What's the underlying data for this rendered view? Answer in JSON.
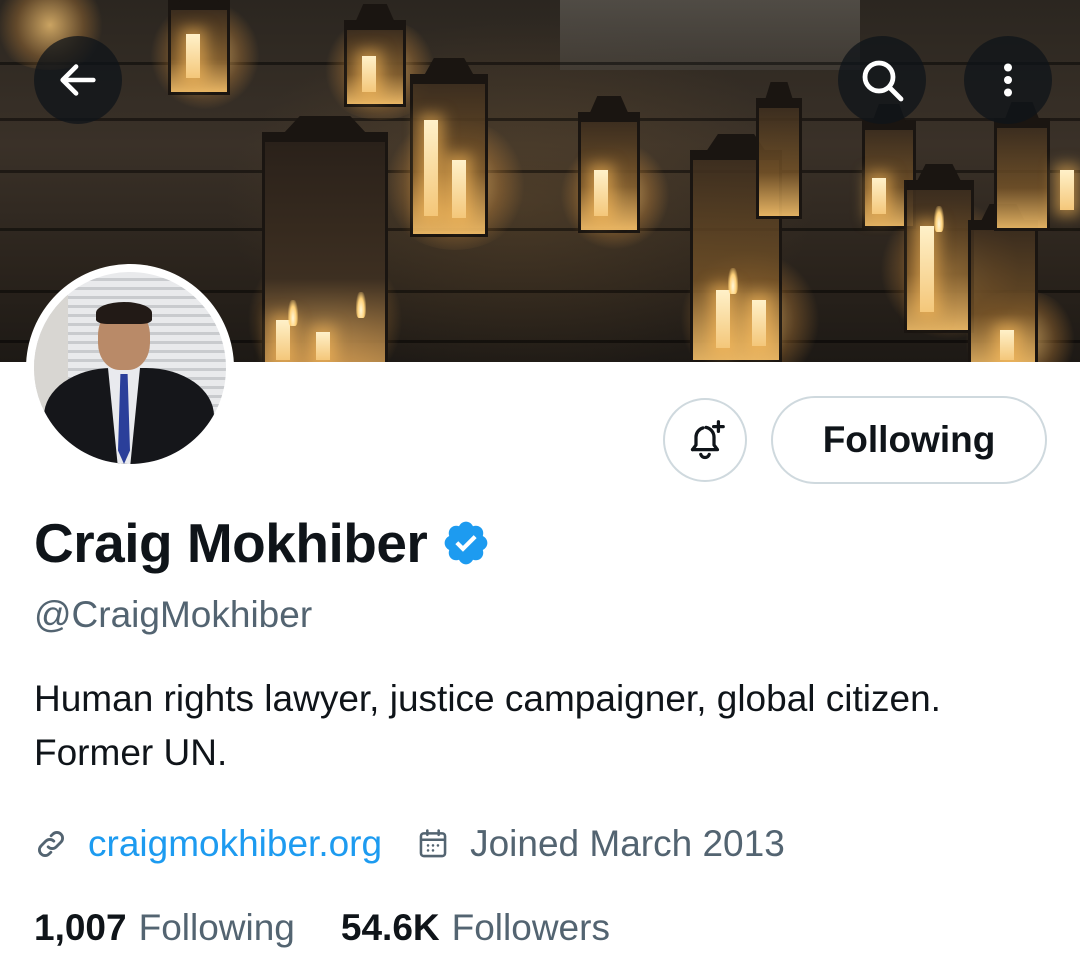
{
  "profile": {
    "display_name": "Craig Mokhiber",
    "handle": "@CraigMokhiber",
    "bio": "Human rights lawyer, justice campaigner, global citizen. Former UN.",
    "website": "craigmokhiber.org",
    "joined": "Joined March 2013",
    "verified": true
  },
  "actions": {
    "following_label": "Following"
  },
  "stats": {
    "following_count": "1,007",
    "following_label": "Following",
    "followers_count": "54.6K",
    "followers_label": "Followers"
  },
  "icons": {
    "back": "arrow-left-icon",
    "search": "search-icon",
    "more": "more-vertical-icon",
    "notify": "bell-plus-icon",
    "verified": "verified-badge-icon",
    "link": "link-icon",
    "calendar": "calendar-icon"
  },
  "colors": {
    "accent": "#1d9bf0",
    "text_primary": "#0f1419",
    "text_secondary": "#536471",
    "border": "#cfd9de"
  }
}
